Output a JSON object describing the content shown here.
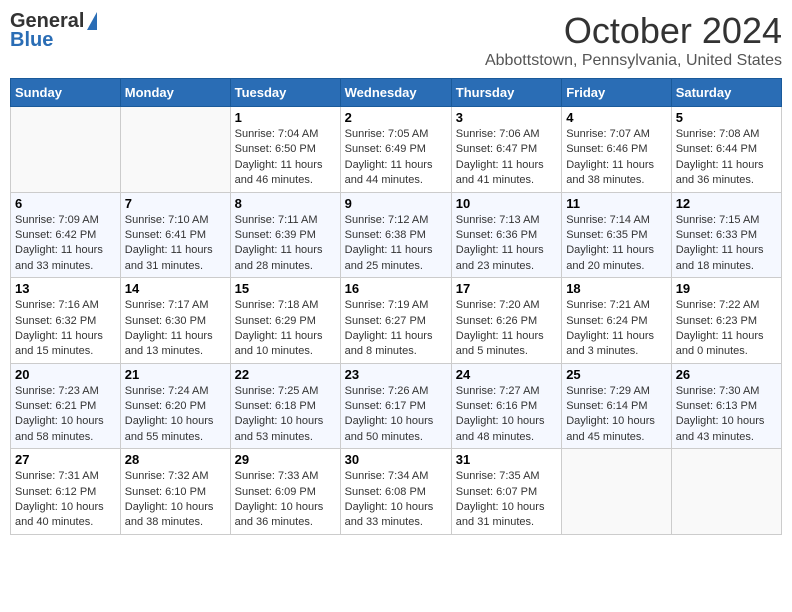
{
  "header": {
    "logo_general": "General",
    "logo_blue": "Blue",
    "month_title": "October 2024",
    "subtitle": "Abbottstown, Pennsylvania, United States"
  },
  "days_of_week": [
    "Sunday",
    "Monday",
    "Tuesday",
    "Wednesday",
    "Thursday",
    "Friday",
    "Saturday"
  ],
  "weeks": [
    [
      {
        "day": "",
        "sunrise": "",
        "sunset": "",
        "daylight": ""
      },
      {
        "day": "",
        "sunrise": "",
        "sunset": "",
        "daylight": ""
      },
      {
        "day": "1",
        "sunrise": "Sunrise: 7:04 AM",
        "sunset": "Sunset: 6:50 PM",
        "daylight": "Daylight: 11 hours and 46 minutes."
      },
      {
        "day": "2",
        "sunrise": "Sunrise: 7:05 AM",
        "sunset": "Sunset: 6:49 PM",
        "daylight": "Daylight: 11 hours and 44 minutes."
      },
      {
        "day": "3",
        "sunrise": "Sunrise: 7:06 AM",
        "sunset": "Sunset: 6:47 PM",
        "daylight": "Daylight: 11 hours and 41 minutes."
      },
      {
        "day": "4",
        "sunrise": "Sunrise: 7:07 AM",
        "sunset": "Sunset: 6:46 PM",
        "daylight": "Daylight: 11 hours and 38 minutes."
      },
      {
        "day": "5",
        "sunrise": "Sunrise: 7:08 AM",
        "sunset": "Sunset: 6:44 PM",
        "daylight": "Daylight: 11 hours and 36 minutes."
      }
    ],
    [
      {
        "day": "6",
        "sunrise": "Sunrise: 7:09 AM",
        "sunset": "Sunset: 6:42 PM",
        "daylight": "Daylight: 11 hours and 33 minutes."
      },
      {
        "day": "7",
        "sunrise": "Sunrise: 7:10 AM",
        "sunset": "Sunset: 6:41 PM",
        "daylight": "Daylight: 11 hours and 31 minutes."
      },
      {
        "day": "8",
        "sunrise": "Sunrise: 7:11 AM",
        "sunset": "Sunset: 6:39 PM",
        "daylight": "Daylight: 11 hours and 28 minutes."
      },
      {
        "day": "9",
        "sunrise": "Sunrise: 7:12 AM",
        "sunset": "Sunset: 6:38 PM",
        "daylight": "Daylight: 11 hours and 25 minutes."
      },
      {
        "day": "10",
        "sunrise": "Sunrise: 7:13 AM",
        "sunset": "Sunset: 6:36 PM",
        "daylight": "Daylight: 11 hours and 23 minutes."
      },
      {
        "day": "11",
        "sunrise": "Sunrise: 7:14 AM",
        "sunset": "Sunset: 6:35 PM",
        "daylight": "Daylight: 11 hours and 20 minutes."
      },
      {
        "day": "12",
        "sunrise": "Sunrise: 7:15 AM",
        "sunset": "Sunset: 6:33 PM",
        "daylight": "Daylight: 11 hours and 18 minutes."
      }
    ],
    [
      {
        "day": "13",
        "sunrise": "Sunrise: 7:16 AM",
        "sunset": "Sunset: 6:32 PM",
        "daylight": "Daylight: 11 hours and 15 minutes."
      },
      {
        "day": "14",
        "sunrise": "Sunrise: 7:17 AM",
        "sunset": "Sunset: 6:30 PM",
        "daylight": "Daylight: 11 hours and 13 minutes."
      },
      {
        "day": "15",
        "sunrise": "Sunrise: 7:18 AM",
        "sunset": "Sunset: 6:29 PM",
        "daylight": "Daylight: 11 hours and 10 minutes."
      },
      {
        "day": "16",
        "sunrise": "Sunrise: 7:19 AM",
        "sunset": "Sunset: 6:27 PM",
        "daylight": "Daylight: 11 hours and 8 minutes."
      },
      {
        "day": "17",
        "sunrise": "Sunrise: 7:20 AM",
        "sunset": "Sunset: 6:26 PM",
        "daylight": "Daylight: 11 hours and 5 minutes."
      },
      {
        "day": "18",
        "sunrise": "Sunrise: 7:21 AM",
        "sunset": "Sunset: 6:24 PM",
        "daylight": "Daylight: 11 hours and 3 minutes."
      },
      {
        "day": "19",
        "sunrise": "Sunrise: 7:22 AM",
        "sunset": "Sunset: 6:23 PM",
        "daylight": "Daylight: 11 hours and 0 minutes."
      }
    ],
    [
      {
        "day": "20",
        "sunrise": "Sunrise: 7:23 AM",
        "sunset": "Sunset: 6:21 PM",
        "daylight": "Daylight: 10 hours and 58 minutes."
      },
      {
        "day": "21",
        "sunrise": "Sunrise: 7:24 AM",
        "sunset": "Sunset: 6:20 PM",
        "daylight": "Daylight: 10 hours and 55 minutes."
      },
      {
        "day": "22",
        "sunrise": "Sunrise: 7:25 AM",
        "sunset": "Sunset: 6:18 PM",
        "daylight": "Daylight: 10 hours and 53 minutes."
      },
      {
        "day": "23",
        "sunrise": "Sunrise: 7:26 AM",
        "sunset": "Sunset: 6:17 PM",
        "daylight": "Daylight: 10 hours and 50 minutes."
      },
      {
        "day": "24",
        "sunrise": "Sunrise: 7:27 AM",
        "sunset": "Sunset: 6:16 PM",
        "daylight": "Daylight: 10 hours and 48 minutes."
      },
      {
        "day": "25",
        "sunrise": "Sunrise: 7:29 AM",
        "sunset": "Sunset: 6:14 PM",
        "daylight": "Daylight: 10 hours and 45 minutes."
      },
      {
        "day": "26",
        "sunrise": "Sunrise: 7:30 AM",
        "sunset": "Sunset: 6:13 PM",
        "daylight": "Daylight: 10 hours and 43 minutes."
      }
    ],
    [
      {
        "day": "27",
        "sunrise": "Sunrise: 7:31 AM",
        "sunset": "Sunset: 6:12 PM",
        "daylight": "Daylight: 10 hours and 40 minutes."
      },
      {
        "day": "28",
        "sunrise": "Sunrise: 7:32 AM",
        "sunset": "Sunset: 6:10 PM",
        "daylight": "Daylight: 10 hours and 38 minutes."
      },
      {
        "day": "29",
        "sunrise": "Sunrise: 7:33 AM",
        "sunset": "Sunset: 6:09 PM",
        "daylight": "Daylight: 10 hours and 36 minutes."
      },
      {
        "day": "30",
        "sunrise": "Sunrise: 7:34 AM",
        "sunset": "Sunset: 6:08 PM",
        "daylight": "Daylight: 10 hours and 33 minutes."
      },
      {
        "day": "31",
        "sunrise": "Sunrise: 7:35 AM",
        "sunset": "Sunset: 6:07 PM",
        "daylight": "Daylight: 10 hours and 31 minutes."
      },
      {
        "day": "",
        "sunrise": "",
        "sunset": "",
        "daylight": ""
      },
      {
        "day": "",
        "sunrise": "",
        "sunset": "",
        "daylight": ""
      }
    ]
  ]
}
